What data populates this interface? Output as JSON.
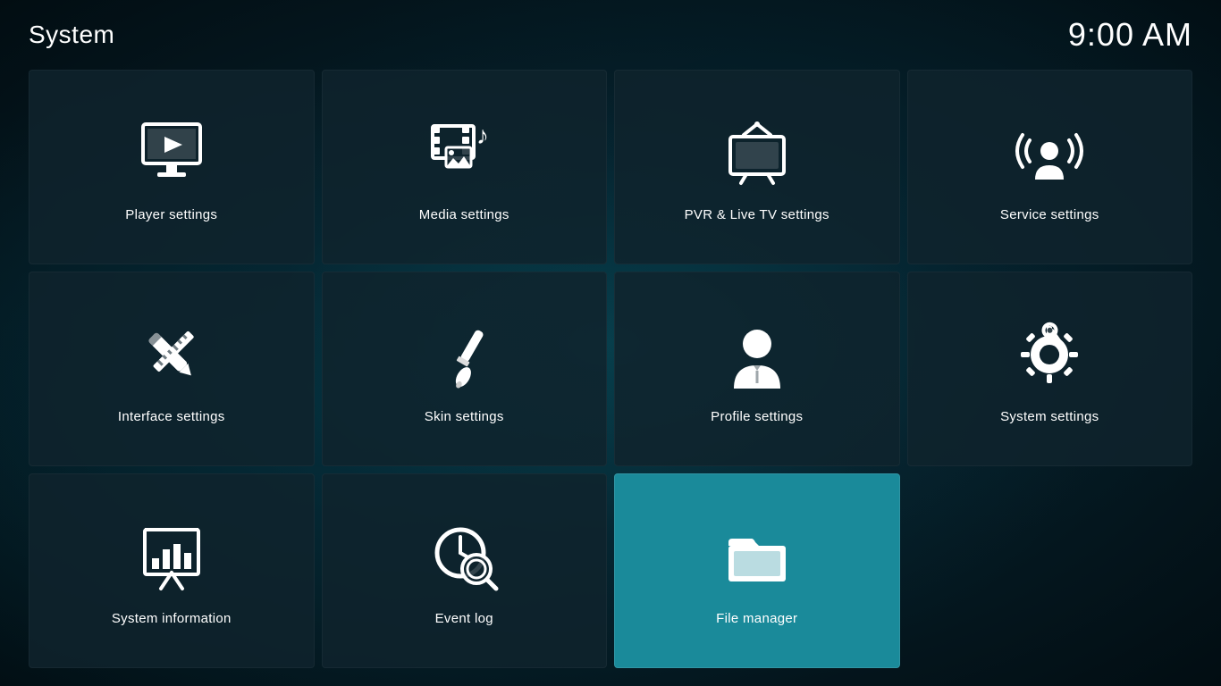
{
  "header": {
    "title": "System",
    "time": "9:00 AM"
  },
  "grid": {
    "items": [
      {
        "id": "player-settings",
        "label": "Player settings",
        "icon": "player",
        "active": false
      },
      {
        "id": "media-settings",
        "label": "Media settings",
        "icon": "media",
        "active": false
      },
      {
        "id": "pvr-settings",
        "label": "PVR & Live TV settings",
        "icon": "pvr",
        "active": false
      },
      {
        "id": "service-settings",
        "label": "Service settings",
        "icon": "service",
        "active": false
      },
      {
        "id": "interface-settings",
        "label": "Interface settings",
        "icon": "interface",
        "active": false
      },
      {
        "id": "skin-settings",
        "label": "Skin settings",
        "icon": "skin",
        "active": false
      },
      {
        "id": "profile-settings",
        "label": "Profile settings",
        "icon": "profile",
        "active": false
      },
      {
        "id": "system-settings",
        "label": "System settings",
        "icon": "system",
        "active": false
      },
      {
        "id": "system-information",
        "label": "System information",
        "icon": "sysinfo",
        "active": false
      },
      {
        "id": "event-log",
        "label": "Event log",
        "icon": "eventlog",
        "active": false
      },
      {
        "id": "file-manager",
        "label": "File manager",
        "icon": "filemanager",
        "active": true
      },
      {
        "id": "empty",
        "label": "",
        "icon": "empty",
        "active": false
      }
    ]
  }
}
